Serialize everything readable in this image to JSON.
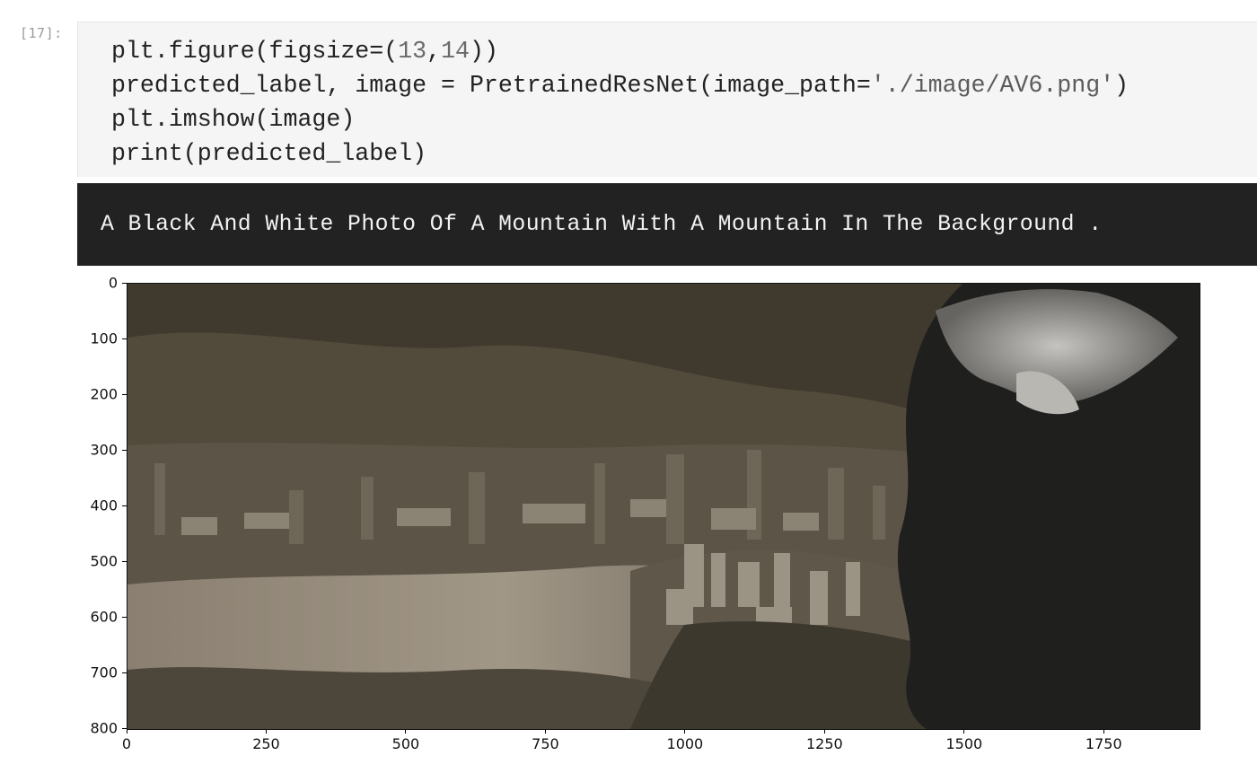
{
  "cell": {
    "prompt": "[17]:",
    "code": {
      "line1": {
        "p1": "plt.figure(figsize=(",
        "n1": "13",
        "p2": ",",
        "n2": "14",
        "p3": "))"
      },
      "line2": {
        "p1": "predicted_label, image = PretrainedResNet(image_path=",
        "s1": "'./image/AV6.png'",
        "p2": ")"
      },
      "line3": "plt.imshow(image)",
      "line4": "print(predicted_label)"
    },
    "output_text": "A Black And White Photo Of A Mountain With A Mountain In The Background ."
  },
  "figure": {
    "image_description_icon": "sepia-city-mountain-photo",
    "yticks": [
      "0",
      "100",
      "200",
      "300",
      "400",
      "500",
      "600",
      "700",
      "800"
    ],
    "xticks": [
      "0",
      "250",
      "500",
      "750",
      "1000",
      "1250",
      "1500",
      "1750"
    ],
    "x_range": [
      0,
      1920
    ],
    "y_range": [
      0,
      800
    ],
    "colors": {
      "output_bg": "#222222",
      "input_bg": "#f5f5f5"
    }
  }
}
